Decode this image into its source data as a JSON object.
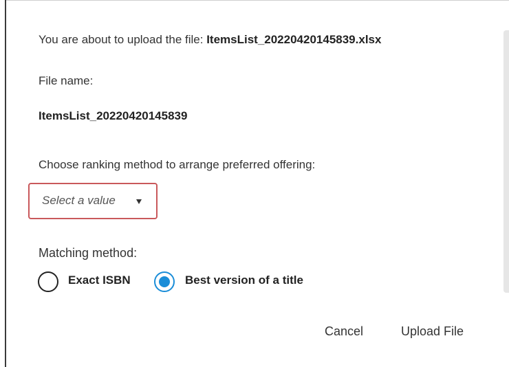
{
  "dialog": {
    "upload_prefix": "You are about to upload the file: ",
    "upload_filename": "ItemsList_20220420145839.xlsx",
    "file_name_label": "File name:",
    "file_name_value": "ItemsList_20220420145839",
    "ranking_label": "Choose ranking method to arrange preferred offering:",
    "ranking_select": {
      "placeholder": "Select a value",
      "selected": "",
      "icon": "caret-down-icon"
    },
    "matching_label": "Matching method:",
    "matching_options": [
      {
        "label": "Exact ISBN",
        "selected": false
      },
      {
        "label": "Best version of a title",
        "selected": true
      }
    ],
    "buttons": {
      "cancel": "Cancel",
      "upload": "Upload File"
    }
  },
  "colors": {
    "select_border": "#c9585b",
    "radio_selected": "#1a8dd8",
    "text": "#333333"
  }
}
